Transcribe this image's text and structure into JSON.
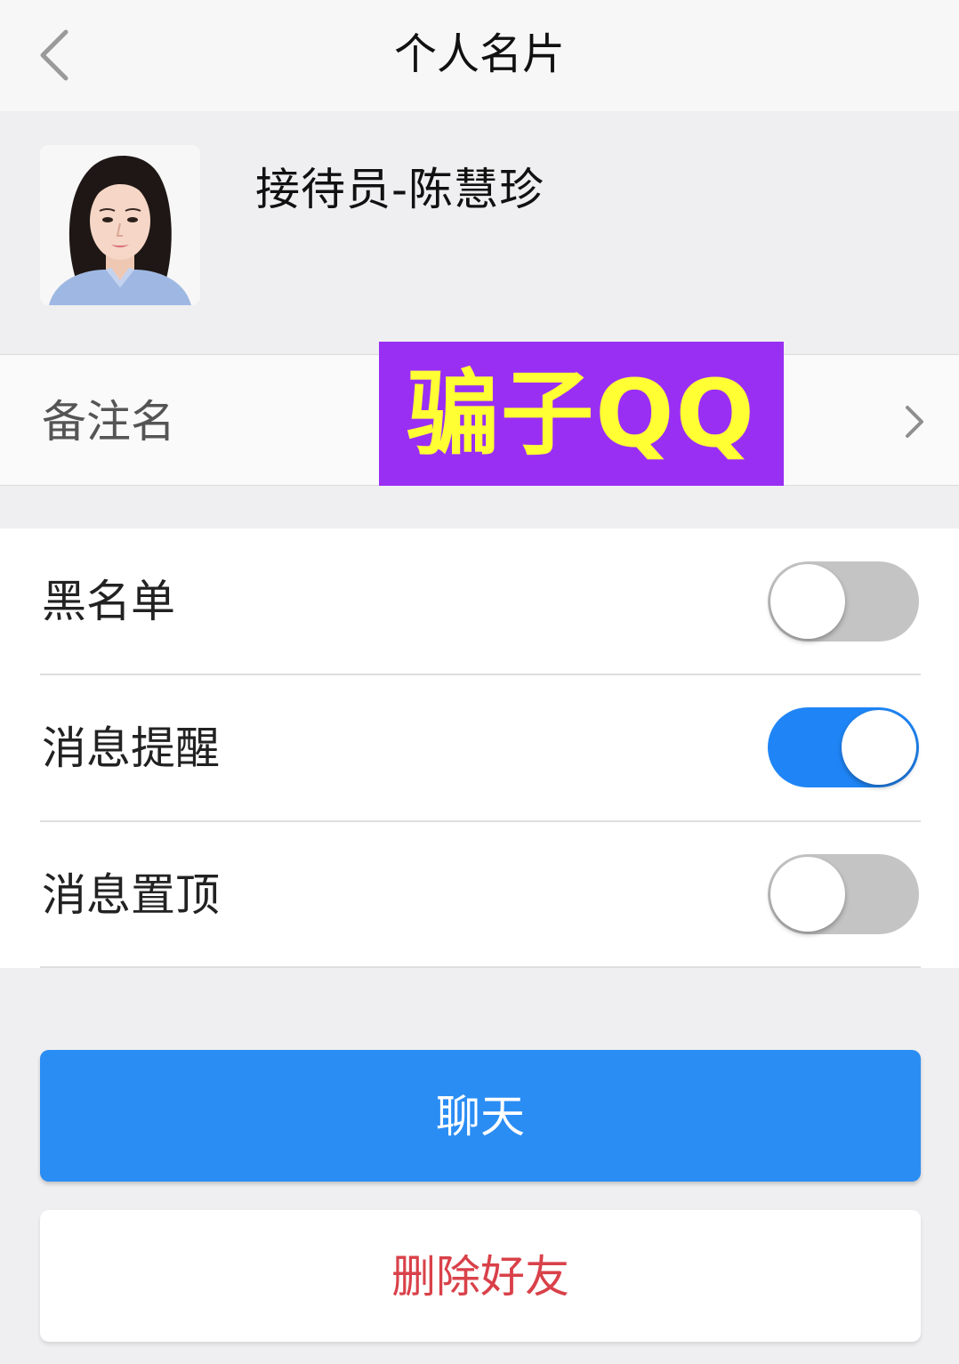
{
  "header": {
    "title": "个人名片",
    "back_icon": "chevron-left-icon"
  },
  "profile": {
    "name": "接待员-陈慧珍",
    "avatar_icon": "avatar-photo"
  },
  "remark": {
    "label": "备注名",
    "chevron_icon": "chevron-right-icon"
  },
  "watermark": {
    "text": "骗子QQ",
    "background": "#9a2ff4",
    "color": "#ffff33"
  },
  "settings": {
    "items": [
      {
        "label": "黑名单",
        "enabled": false
      },
      {
        "label": "消息提醒",
        "enabled": true
      },
      {
        "label": "消息置顶",
        "enabled": false
      }
    ]
  },
  "actions": {
    "chat_label": "聊天",
    "delete_label": "删除好友",
    "chat_color": "#2a8df4",
    "delete_color": "#d94149"
  },
  "colors": {
    "toggle_on": "#1f85f6",
    "toggle_off": "#c4c4c4",
    "page_background": "#efeff1"
  }
}
